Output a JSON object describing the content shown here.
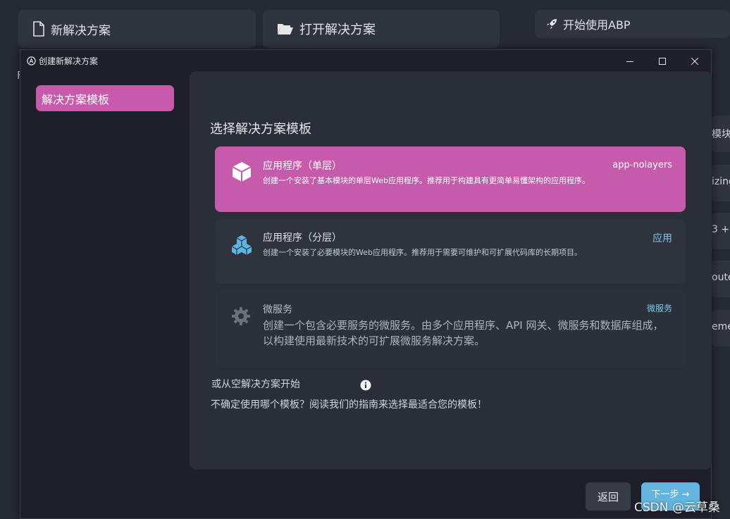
{
  "background": {
    "new_solution": "新解决方案",
    "open_solution": "打开解决方案",
    "get_started": "开始使用ABP",
    "left_fragment": "F",
    "right_fragments": [
      "模块",
      "izing",
      "3 +",
      "oute",
      "eme"
    ]
  },
  "dialog": {
    "title": "创建新解决方案",
    "sidebar": {
      "items": [
        {
          "label": "解决方案模板",
          "selected": true
        }
      ]
    },
    "main": {
      "heading": "选择解决方案模板",
      "templates": [
        {
          "title": "应用程序（单层）",
          "description": "创建一个安装了基本模块的单层Web应用程序。推荐用于构建具有更简单易懂架构的应用程序。",
          "tag": "app-nolayers",
          "icon": "box-icon",
          "selected": true
        },
        {
          "title": "应用程序（分层）",
          "description": "创建一个安装了必要模块的Web应用程序。推荐用于需要可维护和可扩展代码库的长期项目。",
          "tag": "应用",
          "icon": "boxes-icon",
          "selected": false
        },
        {
          "title": "微服务",
          "description": "创建一个包含必要服务的微服务。由多个应用程序、API 网关、微服务和数据库组成，以构建使用最新技术的可扩展微服务解决方案。",
          "tag": "微服务",
          "icon": "gear-icon",
          "selected": false
        }
      ],
      "empty_solution_link": "或从空解决方案开始",
      "guide_text": "不确定使用哪个模板？阅读我们的指南来选择最适合您的模板！"
    },
    "footer": {
      "back_label": "返回",
      "next_label": "下一步 →"
    }
  },
  "watermark": "CSDN @云草桑",
  "colors": {
    "accent_pink": "#c75bab",
    "accent_blue": "#63b4df",
    "panel_bg": "#2a2e38",
    "dialog_bg": "#1e1f2a"
  }
}
